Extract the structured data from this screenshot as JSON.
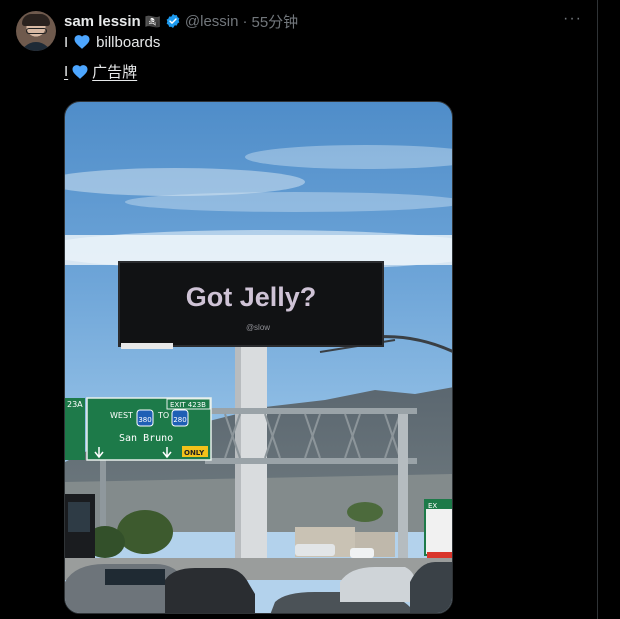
{
  "tweet": {
    "author_name": "sam lessin",
    "author_emoji": "🏴‍☠️",
    "handle": "@lessin",
    "separator": "·",
    "timestamp": "55分钟",
    "line1_prefix": "I",
    "line1_suffix": "billboards",
    "line2_prefix": "I",
    "line2_suffix": "广告牌",
    "heart_color": "#4da6ff",
    "verified_color": "#1d9bf0"
  },
  "image": {
    "billboard_text": "Got Jelly?",
    "billboard_handle": "@slow",
    "sign_exit_left": "23A",
    "sign_exit_right": "EXIT 423B",
    "sign_direction_west": "WEST",
    "sign_direction_to": "TO",
    "sign_route_380": "380",
    "sign_route_280": "280",
    "sign_destination": "San Bruno",
    "sign_only": "ONLY",
    "sign_right_exit": "EX"
  }
}
